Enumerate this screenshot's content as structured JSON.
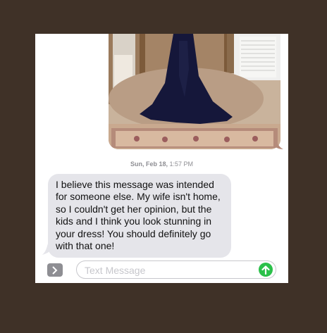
{
  "conversation": {
    "timestamp": {
      "day": "Sun, Feb 18,",
      "time": "1:57 PM"
    },
    "received_message": "I believe this message was intended for someone else. My wife isn't home, so I couldn't get her opinion, but the kids and I think you look stunning in your dress! You should definitely go with that one!"
  },
  "composer": {
    "placeholder": "Text Message",
    "apps_icon": "chevron-right-icon",
    "send_icon": "arrow-up-icon"
  },
  "colors": {
    "background": "#3f3127",
    "received_bubble": "#e5e5ea",
    "send_button": "#2bc04a"
  }
}
